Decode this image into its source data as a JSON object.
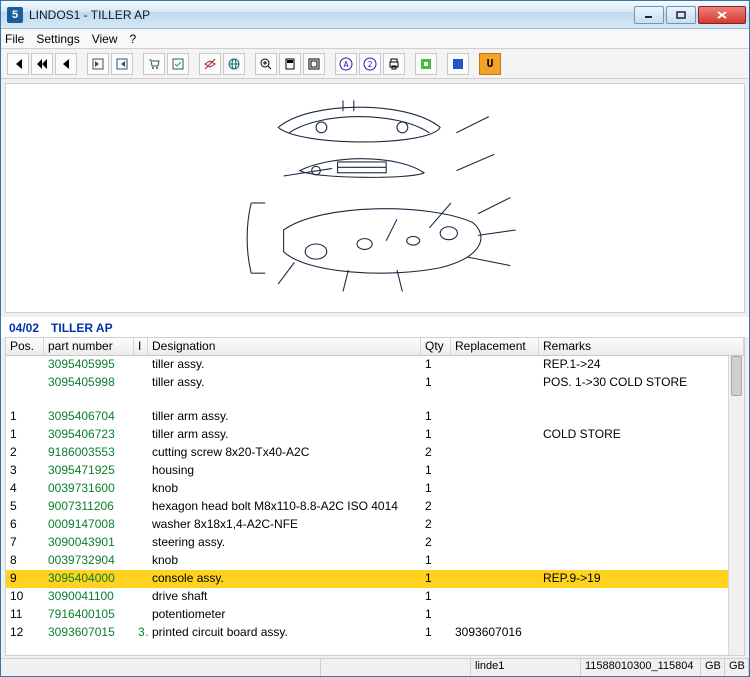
{
  "title": "LINDOS1 - TILLER AP",
  "menus": [
    "File",
    "Settings",
    "View",
    "?"
  ],
  "toolbar_icons": [
    "first-icon",
    "rewind-icon",
    "back-icon",
    "sep",
    "open-icon",
    "save-icon",
    "sep",
    "cart-icon",
    "select-all-icon",
    "sep",
    "layer-off-icon",
    "globe-icon",
    "sep",
    "zoom-icon",
    "page-icon",
    "fit-icon",
    "sep",
    "info-a-icon",
    "info-2-icon",
    "print-icon",
    "sep",
    "green-icon",
    "sep",
    "blue-icon",
    "sep",
    "u-icon"
  ],
  "section": {
    "code": "04/02",
    "name": "TILLER AP"
  },
  "columns": {
    "pos": "Pos.",
    "part": "part number",
    "i": "I",
    "desig": "Designation",
    "qty": "Qty",
    "repl": "Replacement",
    "rem": "Remarks"
  },
  "rows": [
    {
      "pos": "",
      "part": "3095405995",
      "i": "",
      "desig": "tiller assy.",
      "qty": "1",
      "repl": "",
      "rem": "REP.1->24",
      "selected": false
    },
    {
      "pos": "",
      "part": "3095405998",
      "i": "",
      "desig": "tiller assy.",
      "qty": "1",
      "repl": "",
      "rem": "POS. 1->30 COLD STORE",
      "selected": false,
      "wrap": true
    },
    {
      "pos": "1",
      "part": "3095406704",
      "i": "",
      "desig": "tiller arm assy.",
      "qty": "1",
      "repl": "",
      "rem": "",
      "selected": false
    },
    {
      "pos": "1",
      "part": "3095406723",
      "i": "",
      "desig": "tiller arm assy.",
      "qty": "1",
      "repl": "",
      "rem": "COLD STORE",
      "selected": false
    },
    {
      "pos": "2",
      "part": "9186003553",
      "i": "",
      "desig": "cutting screw 8x20-Tx40-A2C",
      "qty": "2",
      "repl": "",
      "rem": "",
      "selected": false
    },
    {
      "pos": "3",
      "part": "3095471925",
      "i": "",
      "desig": "housing",
      "qty": "1",
      "repl": "",
      "rem": "",
      "selected": false
    },
    {
      "pos": "4",
      "part": "0039731600",
      "i": "",
      "desig": "knob",
      "qty": "1",
      "repl": "",
      "rem": "",
      "selected": false
    },
    {
      "pos": "5",
      "part": "9007311206",
      "i": "",
      "desig": "hexagon head bolt M8x110-8.8-A2C  ISO 4014",
      "qty": "2",
      "repl": "",
      "rem": "",
      "selected": false
    },
    {
      "pos": "6",
      "part": "0009147008",
      "i": "",
      "desig": "washer 8x18x1,4-A2C-NFE",
      "qty": "2",
      "repl": "",
      "rem": "",
      "selected": false
    },
    {
      "pos": "7",
      "part": "3090043901",
      "i": "",
      "desig": "steering assy.",
      "qty": "2",
      "repl": "",
      "rem": "",
      "selected": false
    },
    {
      "pos": "8",
      "part": "0039732904",
      "i": "",
      "desig": "knob",
      "qty": "1",
      "repl": "",
      "rem": "",
      "selected": false
    },
    {
      "pos": "9",
      "part": "3095404000",
      "i": "",
      "desig": "console assy.",
      "qty": "1",
      "repl": "",
      "rem": "REP.9->19",
      "selected": true
    },
    {
      "pos": "10",
      "part": "3090041100",
      "i": "",
      "desig": "drive shaft",
      "qty": "1",
      "repl": "",
      "rem": "",
      "selected": false
    },
    {
      "pos": "11",
      "part": "7916400105",
      "i": "",
      "desig": "potentiometer",
      "qty": "1",
      "repl": "",
      "rem": "",
      "selected": false
    },
    {
      "pos": "12",
      "part": "3093607015",
      "i": "3",
      "desig": "printed circuit board assy.",
      "qty": "1",
      "repl": "3093607016",
      "rem": "",
      "selected": false
    }
  ],
  "statusbar": {
    "pane1": "",
    "pane2": "",
    "pane3": "linde1",
    "pane4": "11588010300_115804",
    "pane5": "GB",
    "pane6": "GB"
  }
}
